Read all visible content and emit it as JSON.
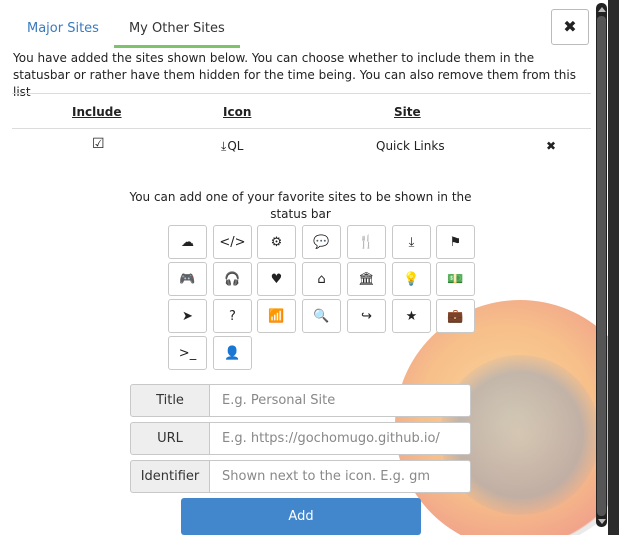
{
  "tabs": [
    {
      "label": "Major Sites",
      "active": false
    },
    {
      "label": "My Other Sites",
      "active": true
    }
  ],
  "close_label": "✖",
  "intro_text": "You have added the sites shown below. You can choose whether to include them in the statusbar or rather have them hidden for the time being. You can also remove them from this list",
  "table": {
    "headers": {
      "include": "Include",
      "icon": "Icon",
      "site": "Site"
    },
    "rows": [
      {
        "include_mark": "☑",
        "icon_glyph": "⤓",
        "icon_id": "QL",
        "site": "Quick Links",
        "remove_mark": "✖"
      }
    ]
  },
  "icon_hint": "You can add one of your favorite sites to be shown in the status bar",
  "icon_choices": [
    {
      "name": "cloud-icon",
      "glyph": "☁"
    },
    {
      "name": "code-icon",
      "glyph": "</>"
    },
    {
      "name": "cogs-icon",
      "glyph": "⚙"
    },
    {
      "name": "comments-icon",
      "glyph": "💬"
    },
    {
      "name": "cutlery-icon",
      "glyph": "🍴"
    },
    {
      "name": "download-icon",
      "glyph": "⤓"
    },
    {
      "name": "flag-icon",
      "glyph": "⚑"
    },
    {
      "name": "gamepad-icon",
      "glyph": "🎮"
    },
    {
      "name": "headphones-icon",
      "glyph": "🎧"
    },
    {
      "name": "heart-icon",
      "glyph": "♥"
    },
    {
      "name": "home-icon",
      "glyph": "⌂"
    },
    {
      "name": "bank-icon",
      "glyph": "🏛"
    },
    {
      "name": "lightbulb-icon",
      "glyph": "💡"
    },
    {
      "name": "money-icon",
      "glyph": "💵"
    },
    {
      "name": "paper-plane-icon",
      "glyph": "➤"
    },
    {
      "name": "question-icon",
      "glyph": "?"
    },
    {
      "name": "rss-icon",
      "glyph": "📶"
    },
    {
      "name": "search-icon",
      "glyph": "🔍"
    },
    {
      "name": "share-icon",
      "glyph": "↪"
    },
    {
      "name": "star-icon",
      "glyph": "★"
    },
    {
      "name": "suitcase-icon",
      "glyph": "💼"
    },
    {
      "name": "terminal-icon",
      "glyph": ">_"
    },
    {
      "name": "user-icon",
      "glyph": "👤"
    }
  ],
  "form": {
    "title": {
      "label": "Title",
      "placeholder": "E.g. Personal Site"
    },
    "url": {
      "label": "URL",
      "placeholder": "E.g. https://gochomugo.github.io/"
    },
    "identifier": {
      "label": "Identifier",
      "placeholder": "Shown next to the icon. E.g. gm"
    }
  },
  "add_label": "Add",
  "colors": {
    "accent": "#4286cc",
    "tab_underline": "#7cc36b",
    "link": "#3a7abf"
  }
}
